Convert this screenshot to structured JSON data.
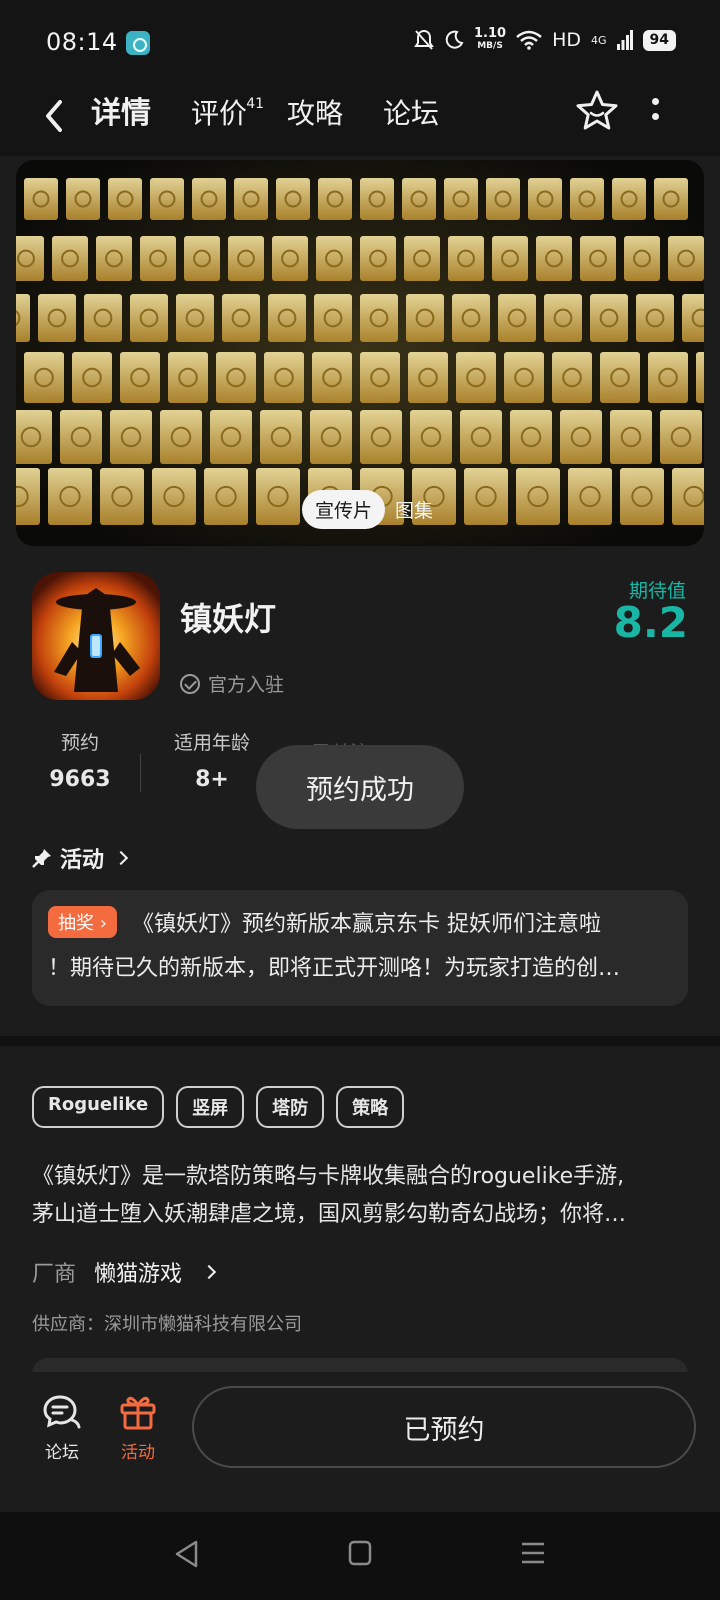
{
  "status_bar": {
    "time": "08:14",
    "net_speed": "1.10",
    "net_unit": "MB/S",
    "hd": "HD",
    "network": "4G",
    "battery": "94"
  },
  "nav": {
    "tabs": [
      {
        "label": "详情",
        "active": true
      },
      {
        "label": "评价",
        "badge": "41"
      },
      {
        "label": "攻略"
      },
      {
        "label": "论坛"
      }
    ]
  },
  "banner": {
    "toggle_active": "宣传片",
    "toggle_inactive": "图集"
  },
  "app": {
    "name": "镇妖灯",
    "official": "官方入驻",
    "expect_label": "期待值",
    "expect_score": "8.2"
  },
  "stats": {
    "reserve_label": "预约",
    "reserve_value": "9663",
    "age_label": "适用年龄",
    "age_value": "8+",
    "follow_label": "已关注"
  },
  "toast": "预约成功",
  "activity": {
    "title": "活动",
    "tag": "抽奖",
    "line1": "《镇妖灯》预约新版本赢京东卡 捉妖师们注意啦",
    "line2": "！期待已久的新版本，即将正式开测咯！为玩家打造的创…"
  },
  "tags": [
    "Roguelike",
    "竖屏",
    "塔防",
    "策略"
  ],
  "description": {
    "line1": "《镇妖灯》是一款塔防策略与卡牌收集融合的roguelike手游,",
    "line2": "茅山道士堕入妖潮肆虐之境，国风剪影勾勒奇幻战场；你将…"
  },
  "vendor": {
    "label": "厂商",
    "name": "懒猫游戏"
  },
  "supplier": "供应商：深圳市懒猫科技有限公司",
  "bottom_bar": {
    "forum_label": "论坛",
    "activity_label": "活动",
    "reserved_button": "已预约"
  },
  "colors": {
    "accent": "#19b6a6",
    "orange": "#f36b3f",
    "background": "#1c1c1c"
  },
  "icons": [
    "back-arrow-icon",
    "star-icon",
    "more-icon",
    "check-circle-icon",
    "pin-icon",
    "chevron-right-icon",
    "forum-chat-icon",
    "gift-icon"
  ]
}
